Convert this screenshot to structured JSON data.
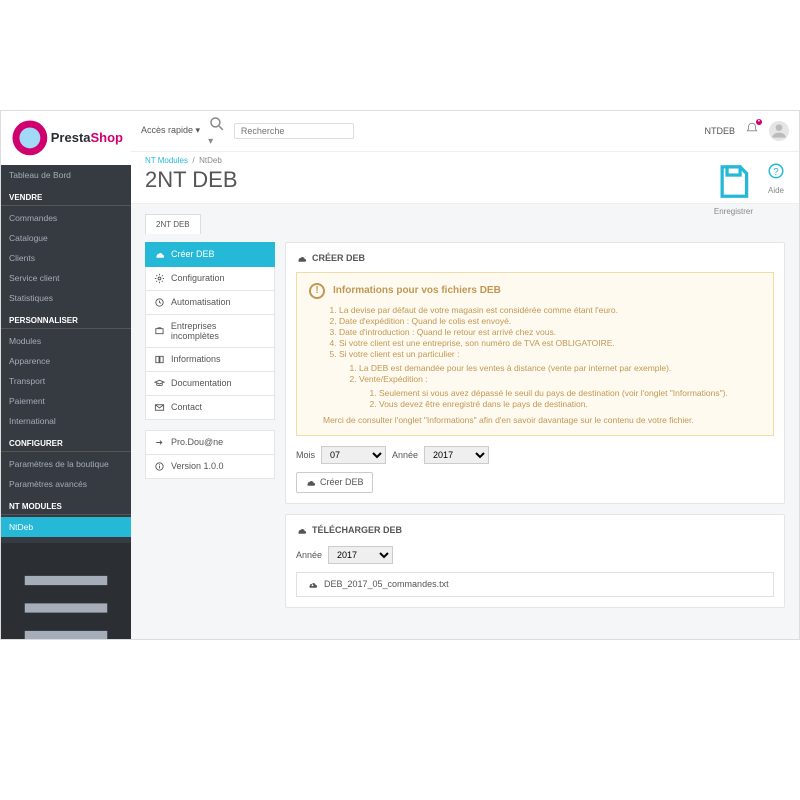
{
  "brand": {
    "part1": "Presta",
    "part2": "Shop"
  },
  "sidebar": {
    "dashboard": "Tableau de Bord",
    "sections": [
      {
        "title": "VENDRE",
        "items": [
          "Commandes",
          "Catalogue",
          "Clients",
          "Service client",
          "Statistiques"
        ]
      },
      {
        "title": "PERSONNALISER",
        "items": [
          "Modules",
          "Apparence",
          "Transport",
          "Paiement",
          "International"
        ]
      },
      {
        "title": "CONFIGURER",
        "items": [
          "Paramètres de la boutique",
          "Paramètres avancés"
        ]
      },
      {
        "title": "NT MODULES",
        "items": [
          "NtDeb"
        ]
      }
    ]
  },
  "topbar": {
    "quick": "Accès rapide",
    "search_placeholder": "Recherche",
    "user": "NTDEB"
  },
  "header": {
    "crumb_parent": "NT Modules",
    "crumb_current": "NtDeb",
    "title": "2NT DEB",
    "save": "Enregistrer",
    "help": "Aide"
  },
  "tab": "2NT DEB",
  "sideTabs": [
    {
      "label": "Créer DEB",
      "active": true
    },
    {
      "label": "Configuration"
    },
    {
      "label": "Automatisation"
    },
    {
      "label": "Entreprises incomplètes"
    },
    {
      "label": "Informations"
    },
    {
      "label": "Documentation"
    },
    {
      "label": "Contact"
    }
  ],
  "sideTabs2": [
    {
      "label": "Pro.Dou@ne"
    },
    {
      "label": "Version 1.0.0"
    }
  ],
  "create": {
    "title": "CRÉER DEB",
    "alert": {
      "title": "Informations pour vos fichiers DEB",
      "i1": "La devise par défaut de votre magasin est considérée comme étant l'euro.",
      "i2": "Date d'expédition : Quand le colis est envoyé.",
      "i3": "Date d'introduction : Quand le retour est arrivé chez vous.",
      "i4": "Si votre client est une entreprise, son numéro de TVA est OBLIGATOIRE.",
      "i5": "Si votre client est un particulier :",
      "i5a": "La DEB est demandée pour les ventes à distance (vente par internet par exemple).",
      "i5b": "Vente/Expédition :",
      "i5b1": "Seulement si vous avez dépassé le seuil du pays de destination (voir l'onglet \"Informations\").",
      "i5b2": "Vous devez être enregistré dans le pays de destination.",
      "foot": "Merci de consulter l'onglet \"Informations\" afin d'en savoir davantage sur le contenu de votre fichier."
    },
    "month_label": "Mois",
    "month_value": "07",
    "year_label": "Année",
    "year_value": "2017",
    "button": "Créer DEB"
  },
  "download": {
    "title": "TÉLÉCHARGER DEB",
    "year_label": "Année",
    "year_value": "2017",
    "file": "DEB_2017_05_commandes.txt"
  }
}
